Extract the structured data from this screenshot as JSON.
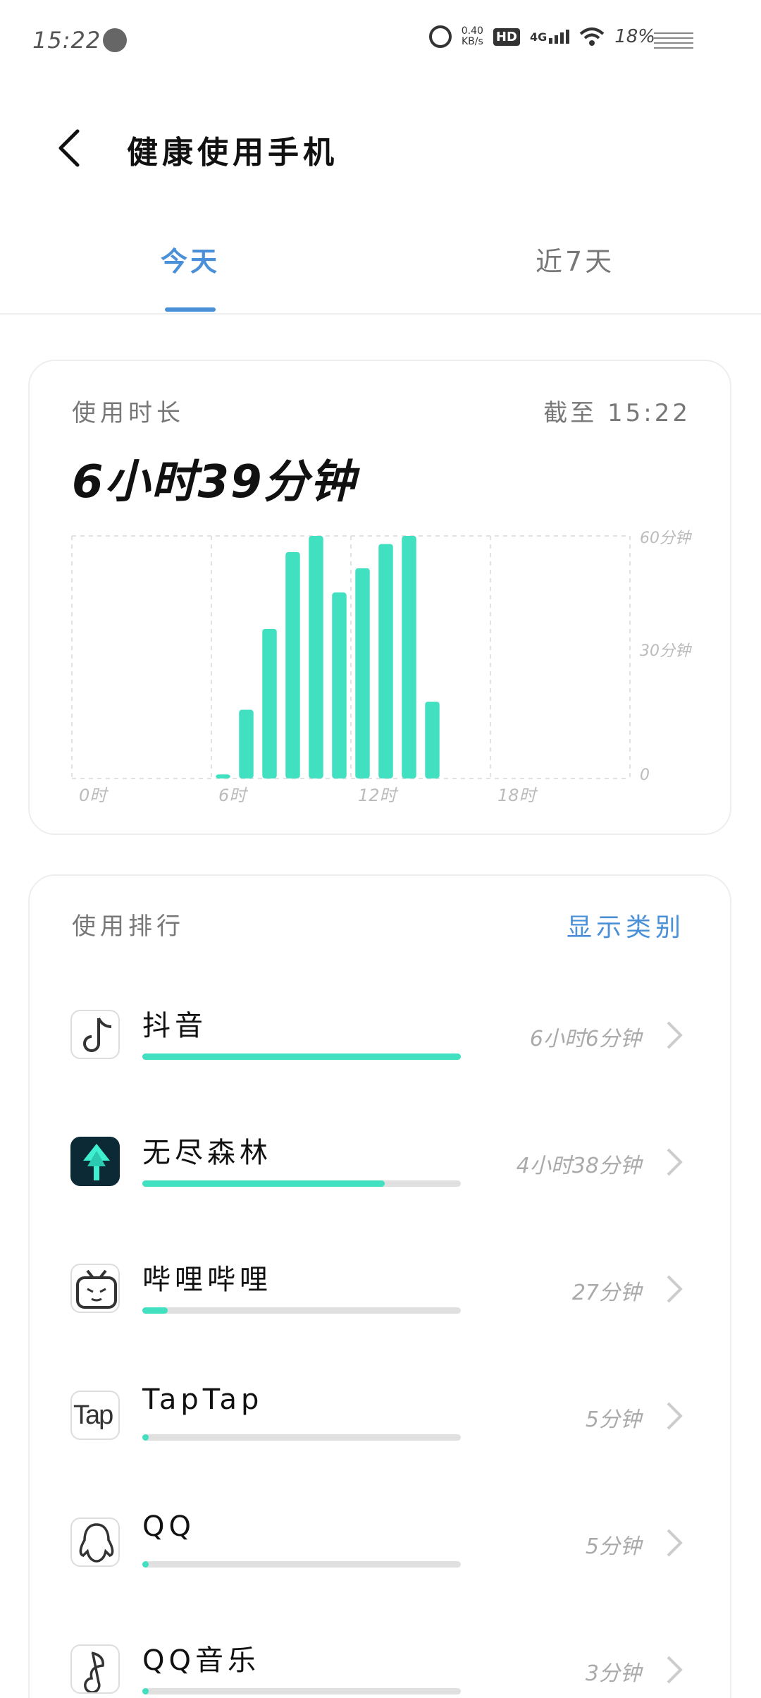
{
  "status_bar": {
    "time": "15:22",
    "net_speed_value": "0.40",
    "net_speed_unit": "KB/s",
    "hd": "HD",
    "network": "4G",
    "battery": "18%"
  },
  "header": {
    "title": "健康使用手机"
  },
  "tabs": [
    {
      "label": "今天",
      "active": true
    },
    {
      "label": "近7天",
      "active": false
    }
  ],
  "usage": {
    "label": "使用时长",
    "as_of": "截至 15:22",
    "total": "6小时39分钟"
  },
  "chart_data": {
    "type": "bar",
    "x_tick_labels": [
      "0时",
      "6时",
      "12时",
      "18时"
    ],
    "y_tick_labels": [
      "60分钟",
      "30分钟",
      "0"
    ],
    "ylim": [
      0,
      60
    ],
    "hours": [
      6,
      7,
      8,
      9,
      10,
      11,
      12,
      13,
      14,
      15
    ],
    "values": [
      1,
      17,
      37,
      56,
      60,
      46,
      52,
      58,
      60,
      19
    ],
    "color": "#40e0c0"
  },
  "ranking": {
    "label": "使用排行",
    "category_button": "显示类别",
    "apps": [
      {
        "name": "抖音",
        "duration": "6小时6分钟",
        "ratio": 1.0,
        "icon": "douyin-icon"
      },
      {
        "name": "无尽森林",
        "duration": "4小时38分钟",
        "ratio": 0.76,
        "icon": "forest-icon"
      },
      {
        "name": "哔哩哔哩",
        "duration": "27分钟",
        "ratio": 0.08,
        "icon": "bilibili-icon"
      },
      {
        "name": "TapTap",
        "duration": "5分钟",
        "ratio": 0.015,
        "icon": "taptap-icon"
      },
      {
        "name": "QQ",
        "duration": "5分钟",
        "ratio": 0.015,
        "icon": "qq-icon"
      },
      {
        "name": "QQ音乐",
        "duration": "3分钟",
        "ratio": 0.01,
        "icon": "qqmusic-icon"
      }
    ]
  },
  "icons": {
    "taptap_text": "Tap"
  }
}
